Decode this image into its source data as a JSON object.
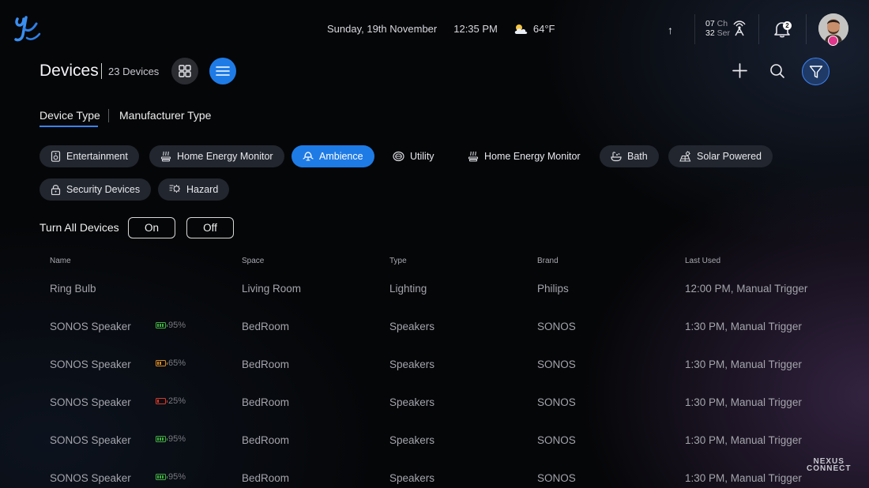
{
  "topbar": {
    "date": "Sunday, 19th November",
    "time": "12:35 PM",
    "temperature": "64°F",
    "weather_icon": "partly-cloudy-icon",
    "up_arrow": "↑",
    "channel": {
      "ch_num": "07",
      "ch_unit": "Ch",
      "ser_num": "32",
      "ser_unit": "Ser"
    },
    "notification_count": "2"
  },
  "header": {
    "title": "Devices",
    "count": "23 Devices"
  },
  "tabs": [
    {
      "label": "Device Type",
      "active": true
    },
    {
      "label": "Manufacturer Type",
      "active": false
    }
  ],
  "chips": [
    {
      "label": "Entertainment",
      "icon": "speaker-icon"
    },
    {
      "label": "Home Energy Monitor",
      "icon": "energy-icon"
    },
    {
      "label": "Ambience",
      "icon": "lamp-icon",
      "active": true
    },
    {
      "label": "Utility",
      "icon": "washer-icon"
    },
    {
      "label": "Home Energy Monitor",
      "icon": "energy-icon"
    },
    {
      "label": "Bath",
      "icon": "bath-icon"
    },
    {
      "label": "Solar Powered",
      "icon": "solar-icon"
    },
    {
      "label": "Security Devices",
      "icon": "lock-icon"
    },
    {
      "label": "Hazard",
      "icon": "hazard-icon"
    }
  ],
  "turn_all": {
    "label": "Turn All Devices",
    "on": "On",
    "off": "Off"
  },
  "table": {
    "columns": [
      "Name",
      "Space",
      "Type",
      "Brand",
      "Last Used"
    ],
    "rows": [
      {
        "name": "Ring Bulb",
        "battery": "",
        "space": "Living Room",
        "type": "Lighting",
        "brand": "Philips",
        "last_used": "12:00 PM, Manual Trigger"
      },
      {
        "name": "SONOS Speaker",
        "battery": "95%",
        "space": "BedRoom",
        "type": "Speakers",
        "brand": "SONOS",
        "last_used": "1:30 PM, Manual Trigger"
      },
      {
        "name": "SONOS Speaker",
        "battery": "65%",
        "space": "BedRoom",
        "type": "Speakers",
        "brand": "SONOS",
        "last_used": "1:30 PM, Manual Trigger"
      },
      {
        "name": "SONOS Speaker",
        "battery": "25%",
        "space": "BedRoom",
        "type": "Speakers",
        "brand": "SONOS",
        "last_used": "1:30 PM, Manual Trigger"
      },
      {
        "name": "SONOS Speaker",
        "battery": "95%",
        "space": "BedRoom",
        "type": "Speakers",
        "brand": "SONOS",
        "last_used": "1:30 PM, Manual Trigger"
      },
      {
        "name": "SONOS Speaker",
        "battery": "95%",
        "space": "BedRoom",
        "type": "Speakers",
        "brand": "SONOS",
        "last_used": "1:30 PM, Manual Trigger"
      }
    ]
  },
  "colors": {
    "accent": "#1e7be6",
    "battery_high": "#3fae3f",
    "battery_mid": "#d88a1e",
    "battery_low": "#d83a2a"
  },
  "watermark": {
    "line1": "NEXUS",
    "line2": "CONNECT"
  }
}
